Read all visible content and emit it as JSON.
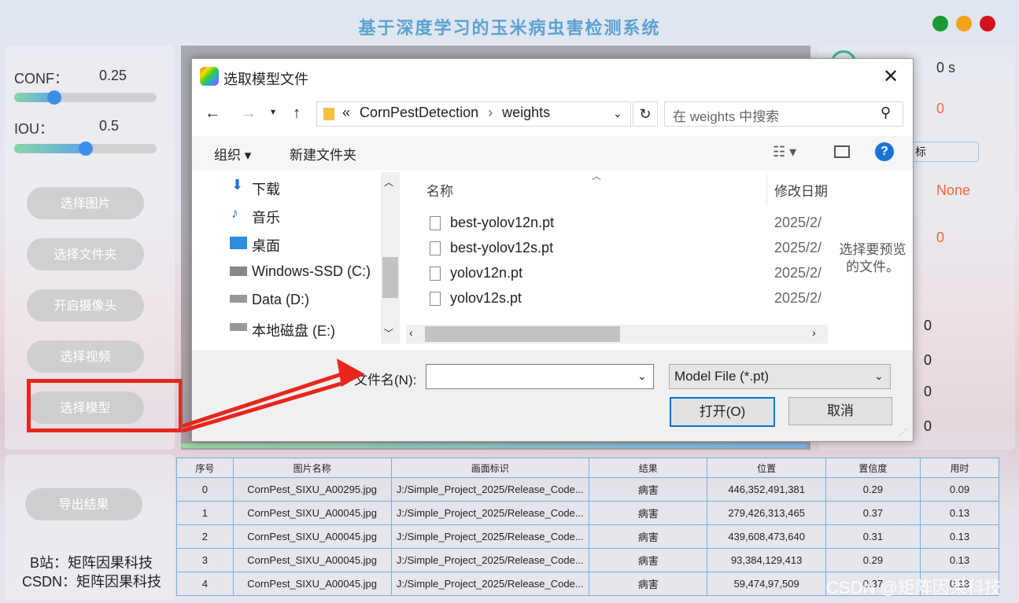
{
  "app": {
    "title": "基于深度学习的玉米病虫害检测系统",
    "window_dots": [
      "#1a9a35",
      "#f3a21b",
      "#d6101a"
    ]
  },
  "left": {
    "conf_label": "CONF：",
    "conf_value": "0.25",
    "conf_level": 0.25,
    "iou_label": "IOU：",
    "iou_value": "0.5",
    "iou_level": 0.5,
    "buttons": [
      "选择图片",
      "选择文件夹",
      "开启摄像头",
      "选择视频",
      "选择模型"
    ],
    "export": "导出结果",
    "credit1": "B站：矩阵因果科技",
    "credit2": "CSDN：矩阵因果科技"
  },
  "right": {
    "time": "0 s",
    "count": "0",
    "target_partial": "标",
    "class": "None",
    "conf": "0",
    "xmin": "0",
    "ymin": "0",
    "xmax": "0",
    "ymax": "0"
  },
  "dialog": {
    "title": "选取模型文件",
    "breadcrumb": [
      "«",
      "CornPestDetection",
      "weights"
    ],
    "search_placeholder": "在 weights 中搜索",
    "toolbar": {
      "organize": "组织 ▾",
      "new_folder": "新建文件夹"
    },
    "nav": [
      "下载",
      "音乐",
      "桌面",
      "Windows-SSD (C:)",
      "Data (D:)",
      "本地磁盘 (E:)"
    ],
    "columns": {
      "name": "名称",
      "modified": "修改日期"
    },
    "files": [
      {
        "name": "best-yolov12n.pt",
        "date": "2025/2/"
      },
      {
        "name": "best-yolov12s.pt",
        "date": "2025/2/"
      },
      {
        "name": "yolov12n.pt",
        "date": "2025/2/"
      },
      {
        "name": "yolov12s.pt",
        "date": "2025/2/"
      }
    ],
    "preview": "选择要预览的文件。",
    "filename_label": "文件名(N):",
    "filename_value": "",
    "filetype": "Model File (*.pt)",
    "open": "打开(O)",
    "cancel": "取消"
  },
  "table": {
    "headers": [
      "序号",
      "图片名称",
      "画面标识",
      "结果",
      "位置",
      "置信度",
      "用时"
    ],
    "rows": [
      [
        "0",
        "CornPest_SIXU_A00295.jpg",
        "J:/Simple_Project_2025/Release_Code...",
        "病害",
        "446,352,491,381",
        "0.29",
        "0.09"
      ],
      [
        "1",
        "CornPest_SIXU_A00045.jpg",
        "J:/Simple_Project_2025/Release_Code...",
        "病害",
        "279,426,313,465",
        "0.37",
        "0.13"
      ],
      [
        "2",
        "CornPest_SIXU_A00045.jpg",
        "J:/Simple_Project_2025/Release_Code...",
        "病害",
        "439,608,473,640",
        "0.31",
        "0.13"
      ],
      [
        "3",
        "CornPest_SIXU_A00045.jpg",
        "J:/Simple_Project_2025/Release_Code...",
        "病害",
        "93,384,129,413",
        "0.29",
        "0.13"
      ],
      [
        "4",
        "CornPest_SIXU_A00045.jpg",
        "J:/Simple_Project_2025/Release_Code...",
        "病害",
        "59,474,97,509",
        "0.37",
        "0.13"
      ]
    ]
  },
  "watermark": "CSDN @矩阵因果科技"
}
